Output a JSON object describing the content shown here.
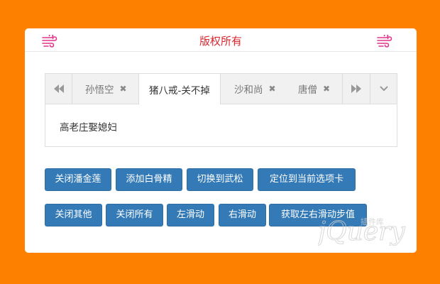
{
  "header": {
    "title": "版权所有",
    "left_icon": "wind-icon",
    "right_icon": "wind-icon",
    "title_color": "#d9272e"
  },
  "tabs": {
    "items": [
      {
        "label": "孙悟空",
        "active": false,
        "closable": true
      },
      {
        "label": "猪八戒-关不掉",
        "active": true,
        "closable": false
      },
      {
        "label": "沙和尚",
        "active": false,
        "closable": true
      },
      {
        "label": "唐僧",
        "active": false,
        "closable": true
      }
    ],
    "content": "高老庄娶媳妇"
  },
  "buttons_row1": [
    "关闭潘金莲",
    "添加白骨精",
    "切换到武松",
    "定位到当前选项卡"
  ],
  "buttons_row2": [
    "关闭其他",
    "关闭所有",
    "左滑动",
    "右滑动",
    "获取左右滑动步值"
  ],
  "colors": {
    "background": "#fe8000",
    "button": "#337ab7"
  },
  "watermark": {
    "text": "jQuery",
    "sub": "插件库"
  }
}
